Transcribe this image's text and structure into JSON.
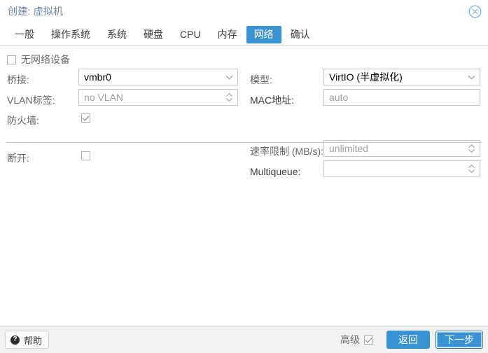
{
  "window": {
    "title": "创建: 虚拟机",
    "close_icon": "close-circle-icon",
    "accent_color": "#3892d4",
    "title_color": "#6b88ad"
  },
  "tabs": [
    {
      "label": "一般",
      "active": false
    },
    {
      "label": "操作系统",
      "active": false
    },
    {
      "label": "系统",
      "active": false
    },
    {
      "label": "硬盘",
      "active": false
    },
    {
      "label": "CPU",
      "active": false
    },
    {
      "label": "内存",
      "active": false
    },
    {
      "label": "网络",
      "active": true
    },
    {
      "label": "确认",
      "active": false
    }
  ],
  "form": {
    "no_network_device": {
      "label": "无网络设备",
      "checked": false
    },
    "left": {
      "bridge": {
        "label": "桥接:",
        "value": "vmbr0",
        "is_placeholder": false,
        "control": "chevron-down-icon"
      },
      "vlan_tag": {
        "label": "VLAN标签:",
        "value": "no VLAN",
        "is_placeholder": true,
        "control": "spinner-icon"
      },
      "firewall": {
        "label": "防火墙:",
        "checked": true
      },
      "disconnect": {
        "label": "断开:",
        "checked": false
      }
    },
    "right": {
      "model": {
        "label": "模型:",
        "value": "VirtIO (半虚拟化)",
        "is_placeholder": false,
        "control": "chevron-down-icon"
      },
      "mac": {
        "label": "MAC地址:",
        "value": "auto",
        "is_placeholder": true,
        "control": "none"
      },
      "rate_limit": {
        "label": "速率限制 (MB/s):",
        "value": "unlimited",
        "is_placeholder": true,
        "control": "spinner-icon"
      },
      "multiqueue": {
        "label": "Multiqueue:",
        "value": "",
        "is_placeholder": true,
        "control": "spinner-icon"
      }
    }
  },
  "footer": {
    "help_label": "帮助",
    "help_icon": "question-mark-icon",
    "advanced_label": "高级",
    "advanced_checked": true,
    "back_label": "返回",
    "next_label": "下一步"
  }
}
